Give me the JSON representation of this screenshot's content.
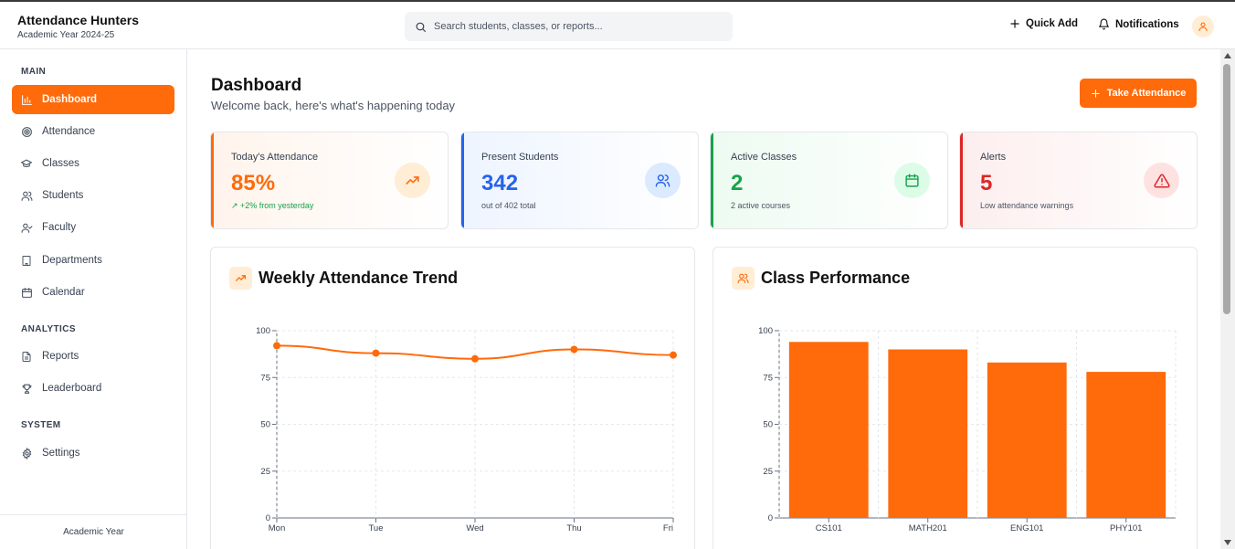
{
  "app": {
    "title": "Attendance Hunters",
    "subtitle": "Academic Year 2024-25"
  },
  "search": {
    "placeholder": "Search students, classes, or reports..."
  },
  "header": {
    "quick_add": "Quick Add",
    "notifications": "Notifications"
  },
  "sidebar": {
    "sections": [
      "MAIN",
      "ANALYTICS",
      "SYSTEM"
    ],
    "items": [
      {
        "label": "Dashboard",
        "icon": "bar-chart-icon",
        "active": true
      },
      {
        "label": "Attendance",
        "icon": "target-icon"
      },
      {
        "label": "Classes",
        "icon": "graduation-cap-icon"
      },
      {
        "label": "Students",
        "icon": "users-icon"
      },
      {
        "label": "Faculty",
        "icon": "user-check-icon"
      },
      {
        "label": "Departments",
        "icon": "building-icon"
      },
      {
        "label": "Calendar",
        "icon": "calendar-icon"
      },
      {
        "label": "Reports",
        "icon": "file-icon"
      },
      {
        "label": "Leaderboard",
        "icon": "trophy-icon"
      },
      {
        "label": "Settings",
        "icon": "gear-icon"
      }
    ],
    "footer": "Academic Year"
  },
  "page": {
    "title": "Dashboard",
    "subtitle": "Welcome back, here's what's happening today",
    "take_attendance": "Take Attendance"
  },
  "stats": [
    {
      "label": "Today's Attendance",
      "value": "85%",
      "note": "↗ +2% from yesterday",
      "color": "#ff6a0a",
      "icon": "trending-up-icon"
    },
    {
      "label": "Present Students",
      "value": "342",
      "note": "out of 402 total",
      "color": "#2563eb",
      "icon": "users-icon"
    },
    {
      "label": "Active Classes",
      "value": "2",
      "note": "2 active courses",
      "color": "#16a34a",
      "icon": "calendar-icon"
    },
    {
      "label": "Alerts",
      "value": "5",
      "note": "Low attendance warnings",
      "color": "#dc2626",
      "icon": "alert-triangle-icon"
    }
  ],
  "cards": {
    "trend_title": "Weekly Attendance Trend",
    "performance_title": "Class Performance"
  },
  "chart_data": [
    {
      "type": "line",
      "title": "Weekly Attendance Trend",
      "categories": [
        "Mon",
        "Tue",
        "Wed",
        "Thu",
        "Fri"
      ],
      "values": [
        92,
        88,
        85,
        90,
        87
      ],
      "ylim": [
        0,
        100
      ],
      "yticks": [
        0,
        25,
        50,
        75,
        100
      ],
      "grid": true,
      "color": "#ff6a0a"
    },
    {
      "type": "bar",
      "title": "Class Performance",
      "categories": [
        "CS101",
        "MATH201",
        "ENG101",
        "PHY101"
      ],
      "values": [
        94,
        90,
        83,
        78
      ],
      "ylim": [
        0,
        100
      ],
      "yticks": [
        0,
        25,
        50,
        75,
        100
      ],
      "grid": true,
      "color": "#ff6a0a"
    }
  ]
}
